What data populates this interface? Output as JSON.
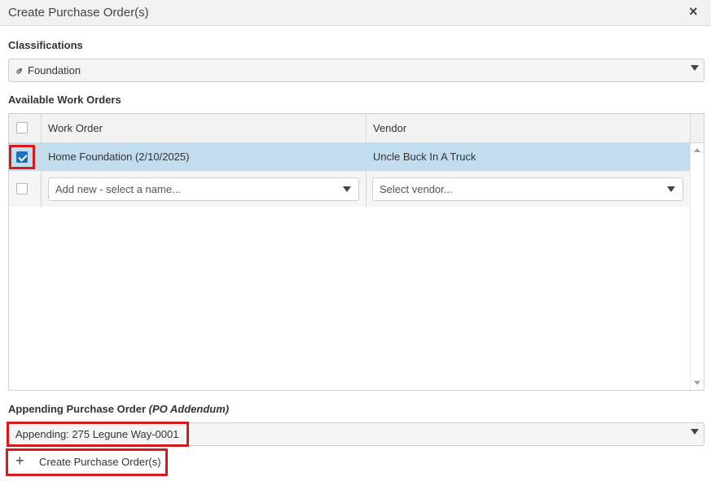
{
  "dialog": {
    "title": "Create Purchase Order(s)",
    "close_icon": "×"
  },
  "classifications": {
    "label": "Classifications",
    "selected": "Foundation",
    "selected_icon": "leaf-icon"
  },
  "work_orders": {
    "label": "Available Work Orders",
    "columns": [
      "Work Order",
      "Vendor"
    ],
    "rows": [
      {
        "checked": true,
        "work_order": "Home Foundation (2/10/2025)",
        "vendor": "Uncle Buck In A Truck"
      }
    ],
    "new_row": {
      "work_order_placeholder": "Add new - select a name...",
      "vendor_placeholder": "Select vendor..."
    }
  },
  "appending": {
    "label": "Appending Purchase Order",
    "label_suffix": "(PO Addendum)",
    "selected": "Appending: 275 Legune Way-0001"
  },
  "create_button": {
    "icon": "+",
    "label": "Create Purchase Order(s)"
  },
  "colors": {
    "selected_row": "#c3ddf0",
    "checkbox_checked": "#1a73b9",
    "highlight": "#d7191c"
  }
}
